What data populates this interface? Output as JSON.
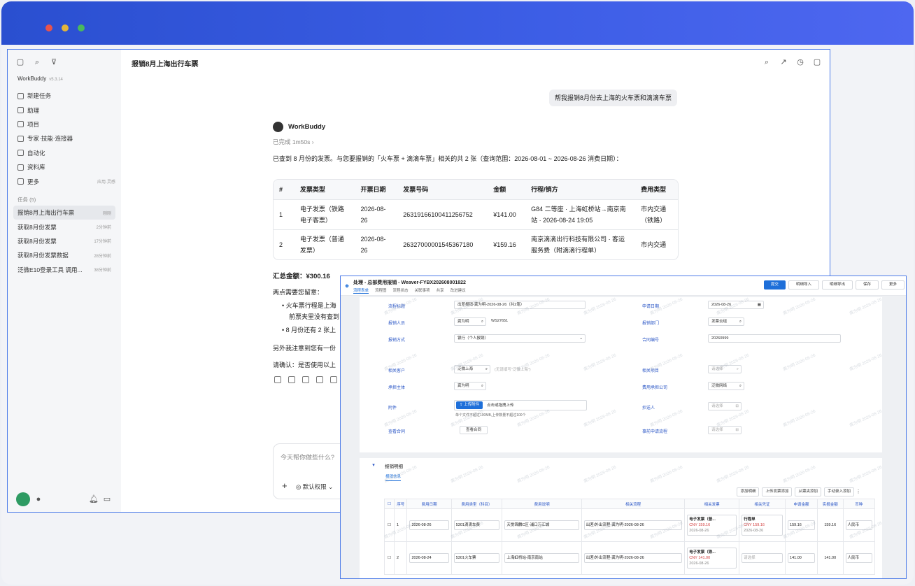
{
  "app": {
    "name": "WorkBuddy",
    "version": "v5.3.14"
  },
  "nav": [
    {
      "label": "新建任务",
      "icon": "plus-circle-icon",
      "right": ""
    },
    {
      "label": "助理",
      "icon": "assistant-icon",
      "right": ""
    },
    {
      "label": "项目",
      "icon": "project-icon",
      "right": ""
    },
    {
      "label": "专家·技能·连接器",
      "icon": "expert-icon",
      "right": ""
    },
    {
      "label": "自动化",
      "icon": "automation-icon",
      "right": ""
    },
    {
      "label": "资料库",
      "icon": "library-icon",
      "right": ""
    },
    {
      "label": "更多",
      "icon": "more-grid-icon",
      "right": "应用·灵感"
    }
  ],
  "tasks_header": "任务 (5)",
  "tasks": [
    {
      "title": "报销8月上海出行车票",
      "time": "刚刚"
    },
    {
      "title": "获取8月份发票",
      "time": "2分钟前"
    },
    {
      "title": "获取8月份发票",
      "time": "17分钟前"
    },
    {
      "title": "获取8月份发票数据",
      "time": "28分钟前"
    },
    {
      "title": "泛微E10登录工具 调用...",
      "time": "38分钟前"
    }
  ],
  "chat": {
    "title": "报销8月上海出行车票",
    "user_message": "帮我报销8月份去上海的火车票和滴滴车票",
    "agent_name": "WorkBuddy",
    "done": "已完成 1m50s ›",
    "intro": "已查到 8 月份的发票。与您要报销的「火车票 + 滴滴车票」相关的共 2 张（查询范围：2026-08-01 ~ 2026-08-26 消费日期）：",
    "table_headers": [
      "#",
      "发票类型",
      "开票日期",
      "发票号码",
      "金额",
      "行程/销方",
      "费用类型"
    ],
    "table_rows": [
      [
        "1",
        "电子发票（铁路电子客票）",
        "2026-08-26",
        "26319166100411256752",
        "¥141.00",
        "G84 二等座 · 上海虹桥站→南京南站 · 2026-08-24 19:05",
        "市内交通（铁路）"
      ],
      [
        "2",
        "电子发票（普通发票）",
        "2026-08-26",
        "26327000001545367180",
        "¥159.16",
        "南京滴滴出行科技有限公司 · 客运服务费（附滴滴行程单）",
        "市内交通"
      ]
    ],
    "total": "汇总金额：¥300.16",
    "notes_h": "两点需要您留意：",
    "note1a": "火车票行程是上海",
    "note1b": "前票夹里没有查到",
    "note2": "8 月份还有 2 张上",
    "line_other": "另外我注意到您有一份",
    "line_confirm": "请确认：是否使用以上",
    "input_placeholder": "今天帮你做些什么?",
    "permission": "默认权限 ⌄"
  },
  "oa": {
    "title": "处理 - 总部费用报销 -  Weaver-FYBX202608001822",
    "tabs": [
      "流程表单",
      "流程图",
      "流程状态",
      "关联事项",
      "共享",
      "改进建议"
    ],
    "buttons": [
      "提交",
      "明细导入",
      "明细导出",
      "保存",
      "更多"
    ],
    "labels": {
      "flow_title": "流程标题",
      "apply_date": "申请日期",
      "reporter": "报销人员",
      "dept": "报销部门",
      "method": "报销方式",
      "contract_no": "合同编号",
      "customer": "相关客户",
      "project": "相关项目",
      "subject": "承担主体",
      "cost_company": "费用承担公司",
      "attachment": "附件",
      "cc": "抄送人",
      "view_contract": "查看合同",
      "pre_apply": "事前申请流程"
    },
    "values": {
      "flow_title": "出差报销-龚为明-2026-08-26（共2笔）",
      "apply_date": "2026-08-26",
      "reporter": "龚为明",
      "reporter_id": "WS27651",
      "dept": "发票云组",
      "method": "银行（个人报销）",
      "contract_no": "20260999",
      "customer": "泛微上海",
      "customer_hint": "(无请填写\"泛微上海\")",
      "project_ph": "请选择",
      "subject": "龚为明",
      "cost_company": "泛微网络",
      "upload": "上传附件",
      "upload_hint": "点击或拖拽上传",
      "upload_limit": "单个文件不超过100MB,上传数量不超过100个",
      "cc_ph": "请选择",
      "view_contract_btn": "查看合同",
      "pre_apply_ph": "请选择"
    },
    "detail_title": "报销明细",
    "detail_tab": "报销信息",
    "detail_buttons": [
      "添加明细",
      "上传发票添加",
      "从票夹添加",
      "手动录入添加"
    ],
    "grid_headers": [
      "序号",
      "费用日期",
      "费用类型（科目）",
      "费用说明",
      "相关流程",
      "相关发票",
      "相关凭证",
      "申请金额",
      "实报金额",
      "币种"
    ],
    "grid_rows": [
      {
        "no": "1",
        "date": "2026-08-26",
        "type": "5301滴滴车费",
        "desc": "天悦锦麟C区-浦口万汇城",
        "flow": "出差/外出流程-龚为明-2026-08-26",
        "inv_name": "电子发票（普...",
        "inv_amt": "CNY 159.16",
        "inv_date": "2026-08-26",
        "voucher": "行程单",
        "v_amt": "CNY 159.16",
        "v_date": "2026-08-26",
        "apply": "159.16",
        "actual": "159.16",
        "currency": "人民币"
      },
      {
        "no": "2",
        "date": "2026-08-24",
        "type": "5301火车票",
        "desc": "上海虹桥站-南京南站",
        "flow": "出差/外出流程-龚为明-2026-08-26",
        "inv_name": "电子发票（铁...",
        "inv_amt": "CNY 141.00",
        "inv_date": "2026-08-26",
        "voucher": "请选择",
        "v_amt": "",
        "v_date": "",
        "apply": "141.00",
        "actual": "141.00",
        "currency": "人民币"
      }
    ],
    "watermark": "龚为明 2026-08-26"
  },
  "colors": {
    "titlebar": "#3d5ee6",
    "accent": "#1e6fd9",
    "label_blue": "#2a56c6",
    "red": "#d23c3c"
  }
}
